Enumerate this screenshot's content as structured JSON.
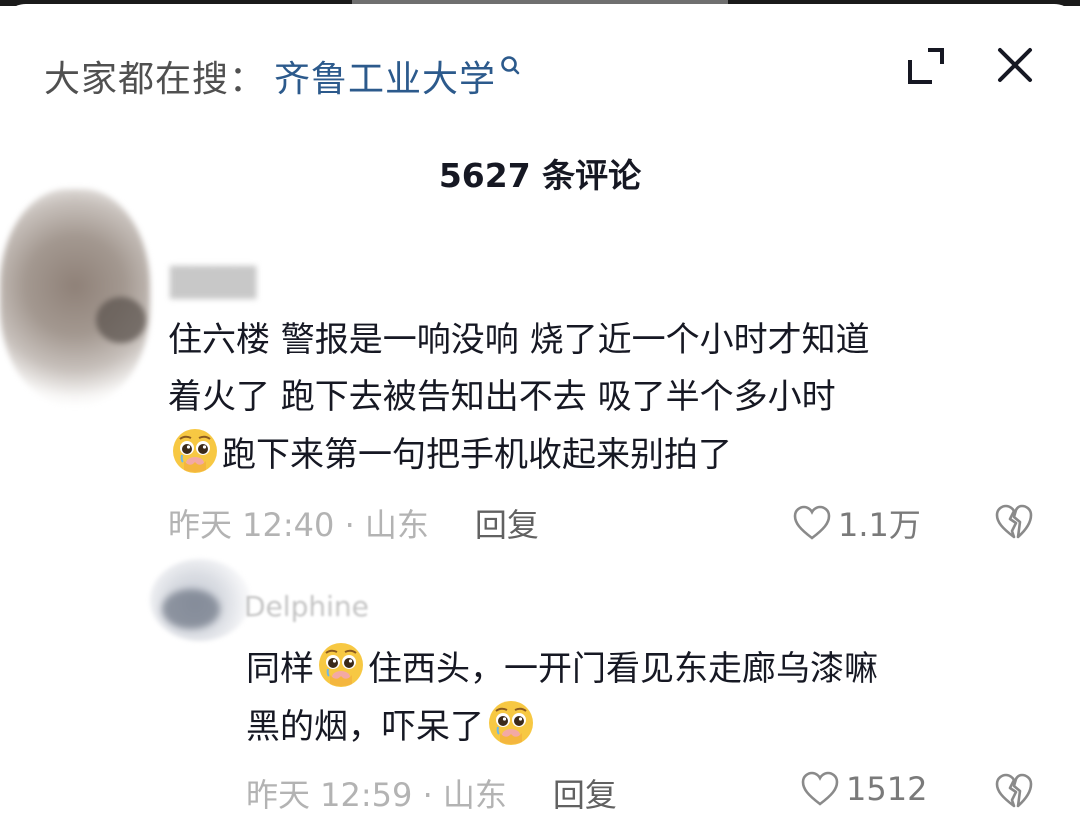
{
  "search": {
    "prefix": "大家都在搜：",
    "term": "齐鲁工业大学"
  },
  "header": {
    "comment_count": "5627 条评论"
  },
  "icons": {
    "search": "search-icon",
    "expand": "expand-icon",
    "close": "close-icon",
    "like": "heart-outline-icon",
    "dislike": "broken-heart-icon",
    "emoji": "pleading-face-emoji"
  },
  "colors": {
    "search_term": "#2c5a8c",
    "text": "#161823",
    "meta": "#a8a8a8"
  },
  "comments": [
    {
      "lines": [
        "住六楼 警报是一响没响 烧了近一个小时才知道",
        "着火了 跑下去被告知出不去 吸了半个多小时",
        "跑下来第一句把手机收起来别拍了"
      ],
      "time": "昨天 12:40 · 山东",
      "reply_label": "回复",
      "likes": "1.1万"
    },
    {
      "username": "Delphine",
      "lines": [
        "同样",
        "住西头，一开门看见东走廊乌漆嘛",
        "黑的烟，吓呆了"
      ],
      "time": "昨天 12:59 · 山东",
      "reply_label": "回复",
      "likes": "1512"
    }
  ]
}
